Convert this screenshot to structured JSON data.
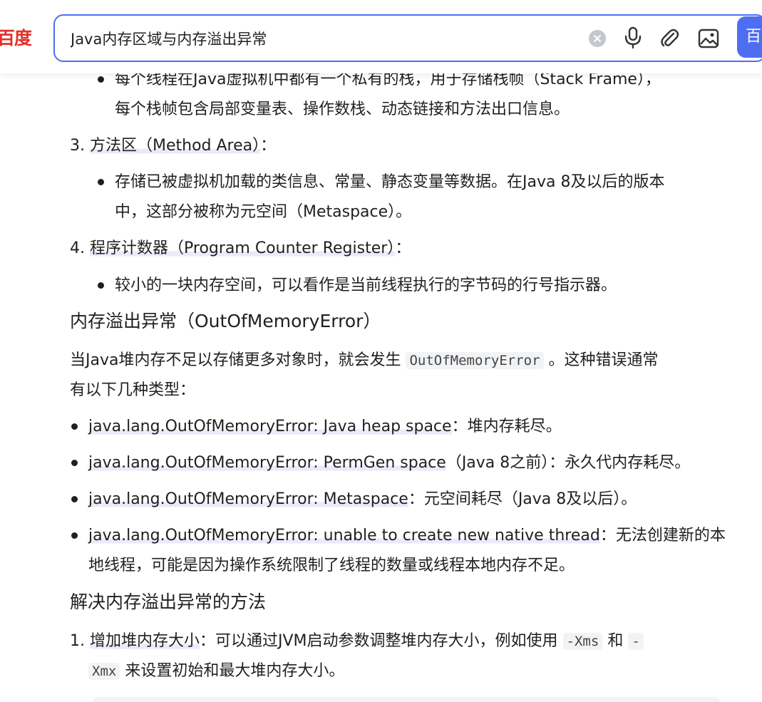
{
  "header": {
    "logo_text": "百度",
    "search_value": "Java内存区域与内存溢出异常",
    "search_button_label": "百"
  },
  "colors": {
    "accent": "#4e6ef2",
    "logo": "#e3302b",
    "highlight": "#ece9fb"
  },
  "icons": [
    "clear-icon",
    "mic-icon",
    "paperclip-icon",
    "image-icon"
  ],
  "content": {
    "stack_bullet": {
      "line1": "每个线程在Java虚拟机中都有一个私有的栈，用于存储栈帧（Stack Frame），",
      "line2": "每个栈帧包含局部变量表、操作数栈、动态链接和方法出口信息。"
    },
    "item3": {
      "num": "3.",
      "title": "方法区（Method Area）",
      "colon": "：",
      "bullet_line1": "存储已被虚拟机加载的类信息、常量、静态变量等数据。在Java 8及以后的版本",
      "bullet_line2": "中，这部分被称为元空间（Metaspace）。"
    },
    "item4": {
      "num": "4.",
      "title": "程序计数器（Program Counter Register）",
      "colon": "：",
      "bullet_line1": "较小的一块内存空间，可以看作是当前线程执行的字节码的行号指示器。"
    },
    "oom_heading": "内存溢出异常（OutOfMemoryError）",
    "oom_intro": {
      "prefix": "当Java堆内存不足以存储更多对象时，就会发生",
      "code": "OutOfMemoryError",
      "suffix": "。这种错误通常",
      "line2": "有以下几种类型："
    },
    "oom_types": [
      {
        "name": "java.lang.OutOfMemoryError: Java heap space",
        "desc": "：堆内存耗尽。"
      },
      {
        "name": "java.lang.OutOfMemoryError: PermGen space",
        "desc": "（Java 8之前）：永久代内存耗尽。"
      },
      {
        "name": "java.lang.OutOfMemoryError: Metaspace",
        "desc": "：元空间耗尽（Java 8及以后）。"
      },
      {
        "name": "java.lang.OutOfMemoryError: unable to create new native thread",
        "desc": "：无法创建新的本",
        "line2": "地线程，可能是因为操作系统限制了线程的数量或线程本地内存不足。"
      }
    ],
    "solutions_heading": "解决内存溢出异常的方法",
    "solution1": {
      "num": "1.",
      "title": "增加堆内存大小",
      "text": "：可以通过JVM启动参数调整堆内存大小，例如使用",
      "code1": "-Xms",
      "and": "和",
      "code2_part1": "-",
      "code2_part2": "Xmx",
      "text2": "来设置初始和最大堆内存大小。"
    }
  }
}
